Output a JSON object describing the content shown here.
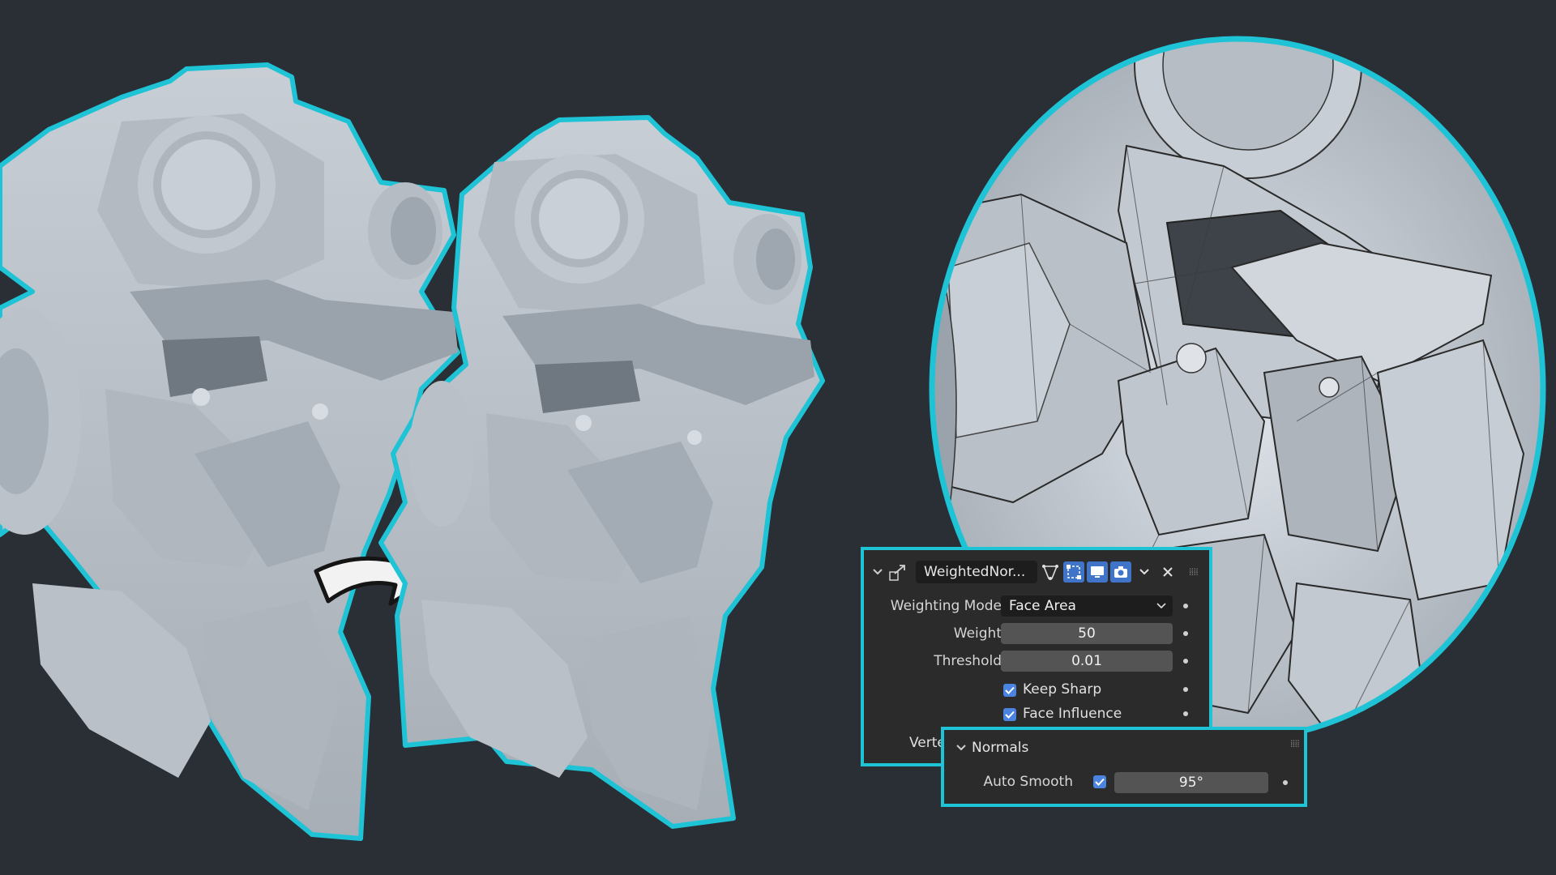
{
  "modifier": {
    "name": "WeightedNor...",
    "rows": {
      "weighting_mode": {
        "label": "Weighting Mode",
        "value": "Face Area"
      },
      "weight": {
        "label": "Weight",
        "value": "50"
      },
      "threshold": {
        "label": "Threshold",
        "value": "0.01"
      }
    },
    "keep_sharp": {
      "label": "Keep Sharp",
      "checked": true
    },
    "face_influence": {
      "label": "Face Influence",
      "checked": true
    },
    "vertex_group_label": "Verte"
  },
  "normals": {
    "title": "Normals",
    "auto_smooth": {
      "label": "Auto Smooth",
      "checked": true,
      "value": "95°"
    }
  },
  "colors": {
    "background": "#2a2e35",
    "outline": "#1fc3d6",
    "model": "#b9bfc6",
    "checkbox": "#4a84e0",
    "active_tool": "#3f74c9"
  }
}
